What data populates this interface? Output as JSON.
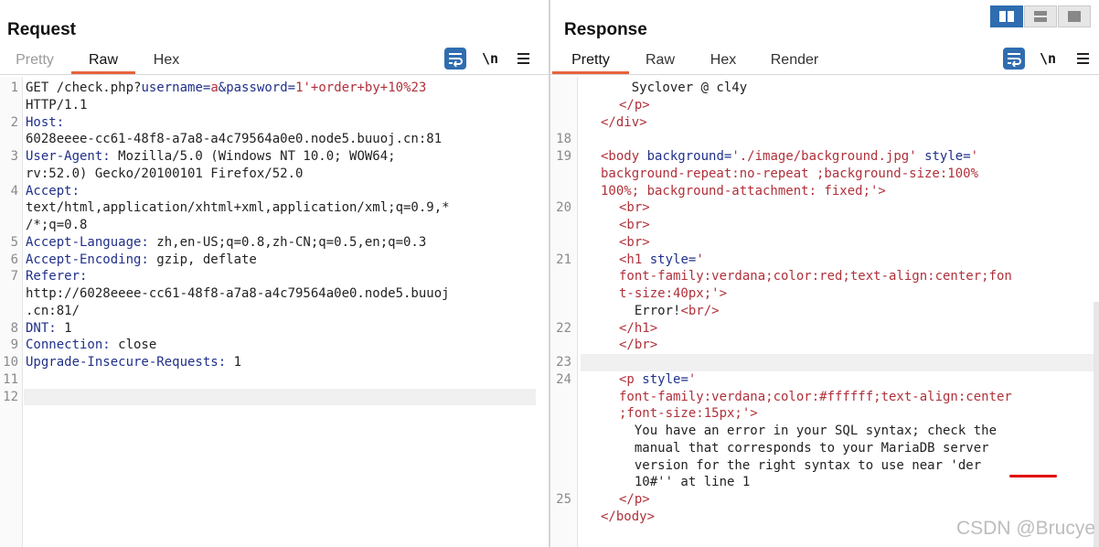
{
  "request": {
    "title": "Request",
    "tabs": [
      "Pretty",
      "Raw",
      "Hex"
    ],
    "active_tab": "Raw",
    "newline_label": "\\n",
    "lines": [
      {
        "n": "1",
        "text": ""
      },
      {
        "n": "",
        "text": "HTTP/1.1"
      },
      {
        "n": "2",
        "text": ""
      },
      {
        "n": "",
        "text": "6028eeee-cc61-48f8-a7a8-a4c79564a0e0.node5.buuoj.cn:81"
      },
      {
        "n": "3",
        "text": ""
      },
      {
        "n": "",
        "text": "rv:52.0) Gecko/20100101 Firefox/52.0"
      },
      {
        "n": "4",
        "text": ""
      },
      {
        "n": "",
        "text": "text/html,application/xhtml+xml,application/xml;q=0.9,*"
      },
      {
        "n": "",
        "text": "/*;q=0.8"
      },
      {
        "n": "5",
        "text": ""
      },
      {
        "n": "6",
        "text": ""
      },
      {
        "n": "7",
        "text": ""
      },
      {
        "n": "",
        "text": "http://6028eeee-cc61-48f8-a7a8-a4c79564a0e0.node5.buuoj"
      },
      {
        "n": "",
        "text": ".cn:81/"
      },
      {
        "n": "8",
        "text": ""
      },
      {
        "n": "9",
        "text": ""
      },
      {
        "n": "10",
        "text": ""
      },
      {
        "n": "11",
        "text": ""
      },
      {
        "n": "12",
        "text": ""
      }
    ],
    "parts": {
      "get": "GET /check.php?",
      "username_key": "username",
      "eq1": "=",
      "username_val": "a",
      "amp": "&",
      "password_key": "password",
      "eq2": "=",
      "password_val": "1'+order+by+10%23",
      "host_key": "Host:",
      "ua_key": "User-Agent:",
      "ua_val": " Mozilla/5.0 (Windows NT 10.0; WOW64;",
      "accept_key": "Accept:",
      "al_key": "Accept-Language:",
      "al_val": " zh,en-US;q=0.8,zh-CN;q=0.5,en;q=0.3",
      "ae_key": "Accept-Encoding:",
      "ae_val": " gzip, deflate",
      "ref_key": "Referer:",
      "dnt_key": "DNT:",
      "dnt_val": " 1",
      "conn_key": "Connection:",
      "conn_val": " close",
      "uir_key": "Upgrade-Insecure-Requests:",
      "uir_val": " 1"
    }
  },
  "response": {
    "title": "Response",
    "tabs": [
      "Pretty",
      "Raw",
      "Hex",
      "Render"
    ],
    "active_tab": "Pretty",
    "newline_label": "\\n",
    "line_numbers": [
      "",
      "",
      "",
      "18",
      "19",
      "",
      "",
      "20",
      "",
      "",
      "21",
      "",
      "",
      "",
      "22",
      "",
      "23",
      "24",
      "",
      "",
      "",
      "",
      "",
      "",
      "25"
    ],
    "t": {
      "syclover": "    Syclover @ cl4y",
      "p_close": "</p>",
      "div_close": "</div>",
      "body_open": "<body",
      "background_attr": "background",
      "bg_val": "'./image/background.jpg'",
      "style_attr": "style",
      "quote_open": "'",
      "body_style1": "background-repeat:no-repeat ;background-size:100%",
      "body_style2": "100%; background-attachment: fixed;'>",
      "br": "<br>",
      "h1_open": "<h1",
      "h1_style1": "font-family:verdana;color:red;text-align:center;fon",
      "h1_style2": "t-size:40px;'>",
      "error_text": "  Error!",
      "br_self": "<br/>",
      "h1_close": "</h1>",
      "br_close": "</br>",
      "p_open": "<p",
      "p_style1": "font-family:verdana;color:#ffffff;text-align:center",
      "p_style2": ";font-size:15px;'>",
      "err1": "  You have an error in your SQL syntax; check the",
      "err2": "  manual that corresponds to your MariaDB server",
      "err3": "  version for the right syntax to use near 'der",
      "err4": "  10#'' at line 1",
      "body_close": "</body>",
      "eq": "=",
      "sp": " "
    }
  },
  "watermark": "CSDN @Brucye"
}
